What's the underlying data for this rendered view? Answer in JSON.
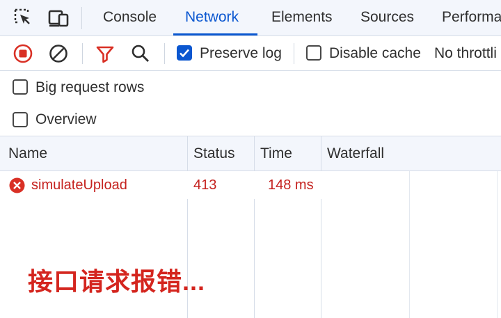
{
  "tabs": [
    {
      "label": "Console"
    },
    {
      "label": "Network",
      "active": true
    },
    {
      "label": "Elements"
    },
    {
      "label": "Sources"
    },
    {
      "label": "Performa"
    }
  ],
  "toolbar": {
    "preserve_log": {
      "label": "Preserve log",
      "checked": true
    },
    "disable_cache": {
      "label": "Disable cache",
      "checked": false
    },
    "throttling": "No throttli"
  },
  "options": {
    "big_rows": {
      "label": "Big request rows",
      "checked": false
    },
    "overview": {
      "label": "Overview",
      "checked": false
    }
  },
  "table": {
    "columns": [
      "Name",
      "Status",
      "Time",
      "Waterfall"
    ],
    "rows": [
      {
        "name": "simulateUpload",
        "status": "413",
        "time": "148 ms",
        "error": true
      }
    ]
  },
  "annotation": "接口请求报错...",
  "colors": {
    "accent": "#0b57d0",
    "error": "#c5221f",
    "annotation": "#d4251e",
    "record": "#d93025"
  },
  "icons": [
    "inspect-element-icon",
    "device-toolbar-icon",
    "record-stop-icon",
    "clear-icon",
    "filter-icon",
    "search-icon",
    "error-icon"
  ]
}
